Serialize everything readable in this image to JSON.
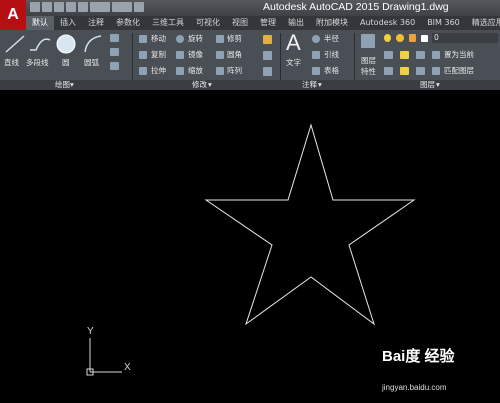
{
  "app": {
    "logo": "A",
    "title": "Autodesk AutoCAD 2015    Drawing1.dwg"
  },
  "tabs": [
    {
      "label": "默认"
    },
    {
      "label": "插入"
    },
    {
      "label": "注释"
    },
    {
      "label": "参数化"
    },
    {
      "label": "三维工具"
    },
    {
      "label": "可视化"
    },
    {
      "label": "视图"
    },
    {
      "label": "管理"
    },
    {
      "label": "输出"
    },
    {
      "label": "附加模块"
    },
    {
      "label": "Autodesk 360"
    },
    {
      "label": "BIM 360"
    },
    {
      "label": "精选应用"
    }
  ],
  "ribbon": {
    "draw": {
      "line": "直线",
      "polyline": "多段线",
      "circle": "圆",
      "arc": "圆弧"
    },
    "modify": {
      "move": "移动",
      "rotate": "旋转",
      "trim": "修剪",
      "copy": "复制",
      "mirror": "镜像",
      "fillet": "圆角",
      "stretch": "拉伸",
      "scale": "缩放",
      "array": "阵列"
    },
    "annotation": {
      "text": "文字",
      "radius": "半径",
      "leader": "引线",
      "table": "表格"
    },
    "layers": {
      "props": "图层",
      "props2": "特性",
      "layer_value": "0",
      "set_current": "置为当前",
      "match": "匹配图层"
    },
    "panels": {
      "draw": "绘图",
      "modify": "修改",
      "annotation": "注释",
      "layers": "图层"
    }
  },
  "canvas": {
    "y_label": "Y",
    "x_label": "X"
  },
  "watermark": {
    "brand": "Bai度 经验",
    "url": "jingyan.baidu.com"
  }
}
